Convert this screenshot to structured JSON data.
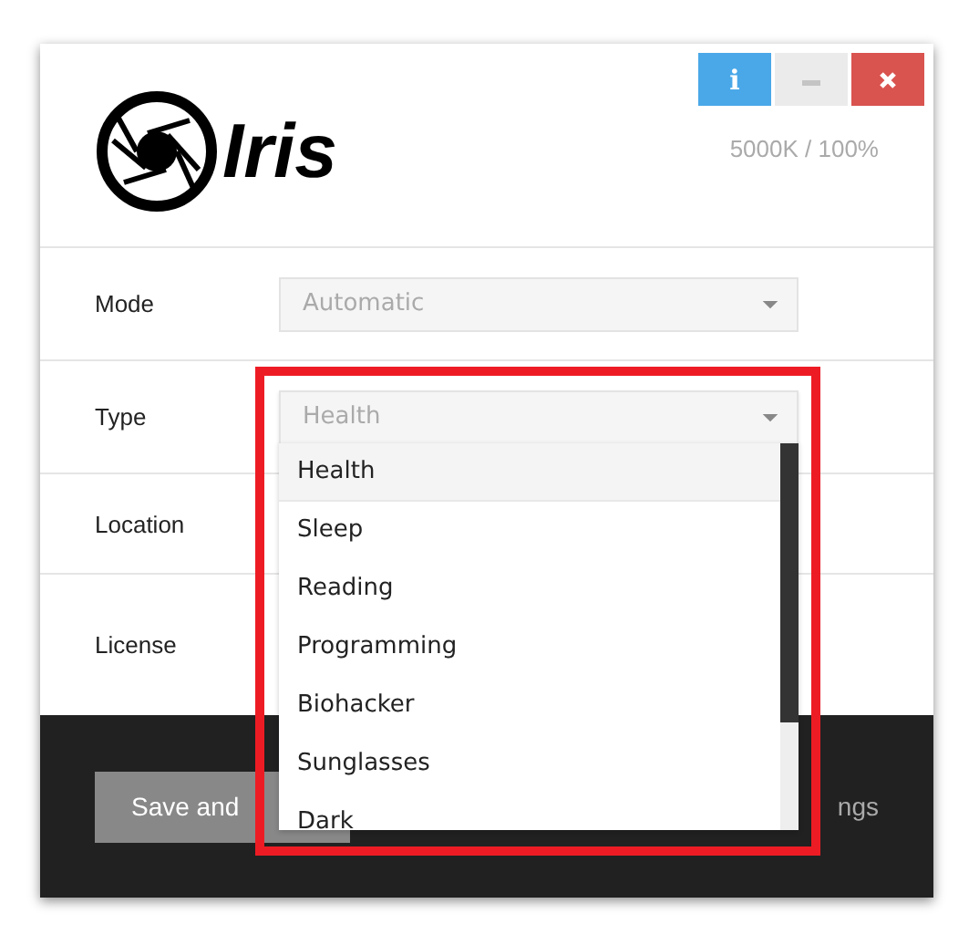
{
  "header": {
    "title": "Iris",
    "status": "5000K / 100%",
    "window_buttons": [
      {
        "kind": "info",
        "label": "i"
      },
      {
        "kind": "minimize"
      },
      {
        "kind": "close"
      }
    ]
  },
  "rows": [
    {
      "label": "Mode",
      "select": {
        "value": "Automatic"
      }
    },
    {
      "label": "Type",
      "select": {
        "value": "Health",
        "expanded": true
      }
    },
    {
      "label": "Location"
    },
    {
      "label": "License"
    }
  ],
  "dropdown": {
    "options": [
      {
        "label": "Health",
        "selected": true
      },
      {
        "label": "Sleep",
        "selected": false
      },
      {
        "label": "Reading",
        "selected": false
      },
      {
        "label": "Programming",
        "selected": false
      },
      {
        "label": "Biohacker",
        "selected": false
      },
      {
        "label": "Sunglasses",
        "selected": false
      },
      {
        "label": "Dark",
        "selected": false
      }
    ]
  },
  "footer": {
    "save_button": "Save and",
    "link": "ngs"
  }
}
